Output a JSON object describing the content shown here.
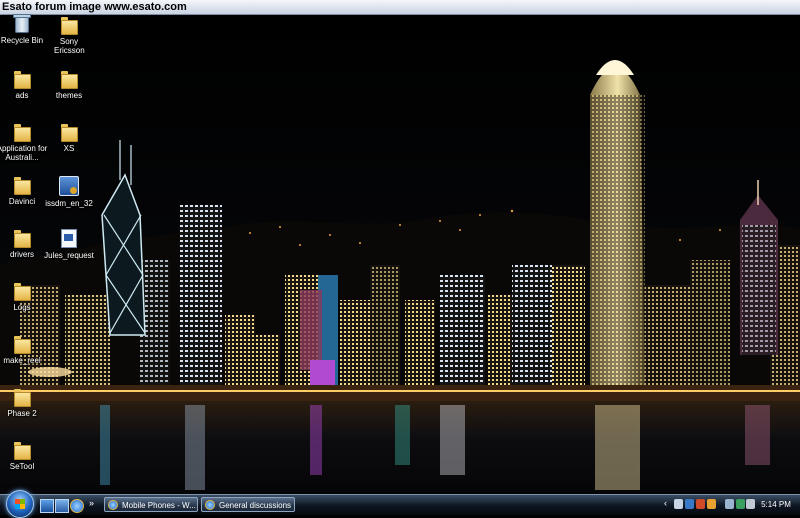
{
  "watermark": {
    "text": "Esato forum image www.esato.com"
  },
  "desktop": {
    "icons": [
      {
        "label": "Recycle Bin"
      },
      {
        "label": "Sony Ericsson"
      },
      {
        "label": "ads"
      },
      {
        "label": "themes"
      },
      {
        "label": "Application for Australi..."
      },
      {
        "label": "XS"
      },
      {
        "label": "Davinci"
      },
      {
        "label": "issdm_en_32"
      },
      {
        "label": "drivers"
      },
      {
        "label": "Jules_request"
      },
      {
        "label": "Logs"
      },
      {
        "label": "make_reel"
      },
      {
        "label": "Phase 2"
      },
      {
        "label": "SeTool"
      }
    ]
  },
  "taskbar": {
    "quick_launch_more": "»",
    "tasks": [
      {
        "label": "Mobile Phones - W..."
      },
      {
        "label": "General discussions ..."
      }
    ],
    "tray_chevron": "‹",
    "clock": "5:14 PM"
  },
  "colors": {
    "taskbar": "#0d1520",
    "wallpaper_sky": "#000000",
    "watermark_bar": "#c9d3e2"
  }
}
